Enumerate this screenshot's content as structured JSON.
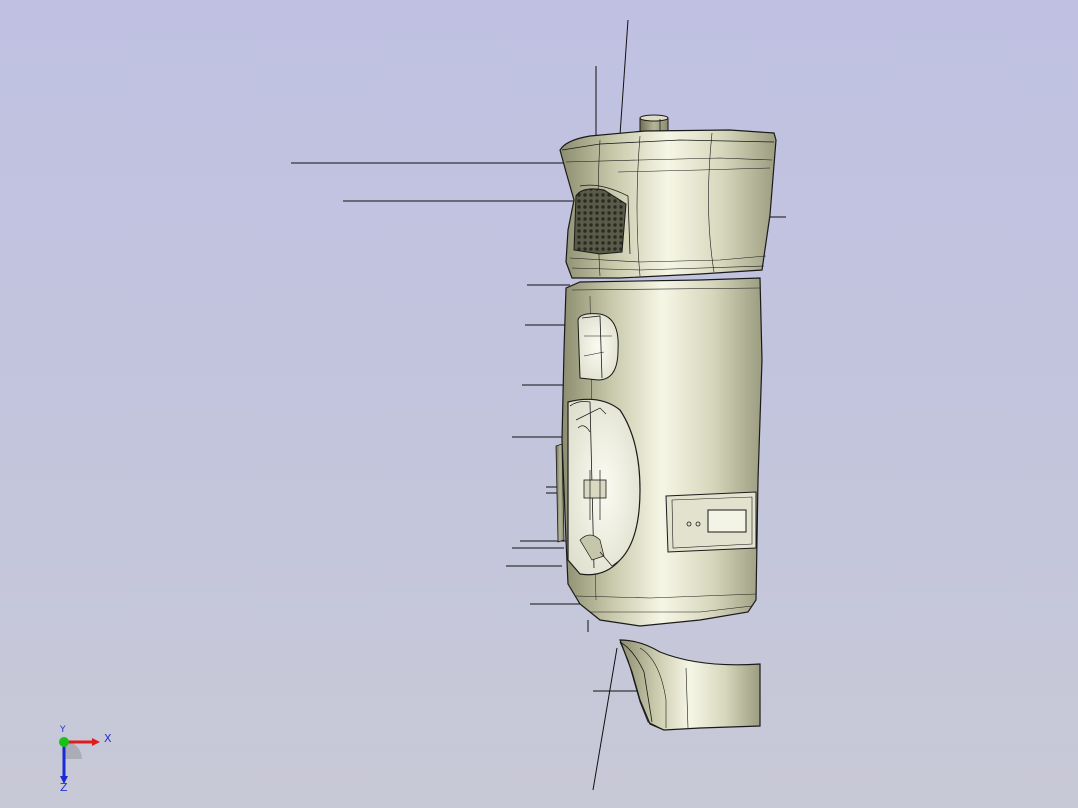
{
  "viewport": {
    "background": "#c2c3de",
    "part_color": "#cfcfb4",
    "edge_color": "#1a1a1a"
  },
  "axes": {
    "x_label": "X",
    "y_label": "Y",
    "z_label": "Z",
    "x_color": "#e01b1b",
    "y_color": "#18c018",
    "z_color": "#1a2ad8"
  }
}
